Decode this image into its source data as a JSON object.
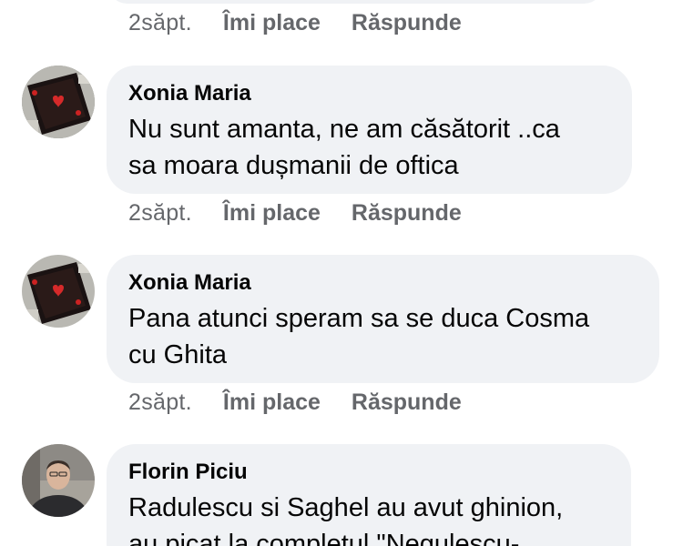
{
  "top_actions": {
    "time": "2săpt.",
    "like": "Îmi place",
    "reply": "Răspunde"
  },
  "comments": [
    {
      "author": "Xonia Maria",
      "text": "Nu sunt amanta, ne am căsătorit ..ca\nsa moara dușmanii de oftica",
      "time": "2săpt.",
      "like": "Îmi place",
      "reply": "Răspunde",
      "avatar_icon": "avatar-dark-hearts"
    },
    {
      "author": "Xonia Maria",
      "text": "Pana atunci speram sa se duca Cosma\ncu Ghita",
      "time": "2săpt.",
      "like": "Îmi place",
      "reply": "Răspunde",
      "avatar_icon": "avatar-dark-hearts"
    },
    {
      "author": "Florin Piciu",
      "text": "Radulescu si Saghel au avut ghinion,\nau picat la completul \"Negulescu-",
      "avatar_icon": "avatar-man-photo"
    }
  ],
  "colors": {
    "bubble": "#f0f2f5",
    "meta": "#65676b",
    "text": "#050505"
  }
}
